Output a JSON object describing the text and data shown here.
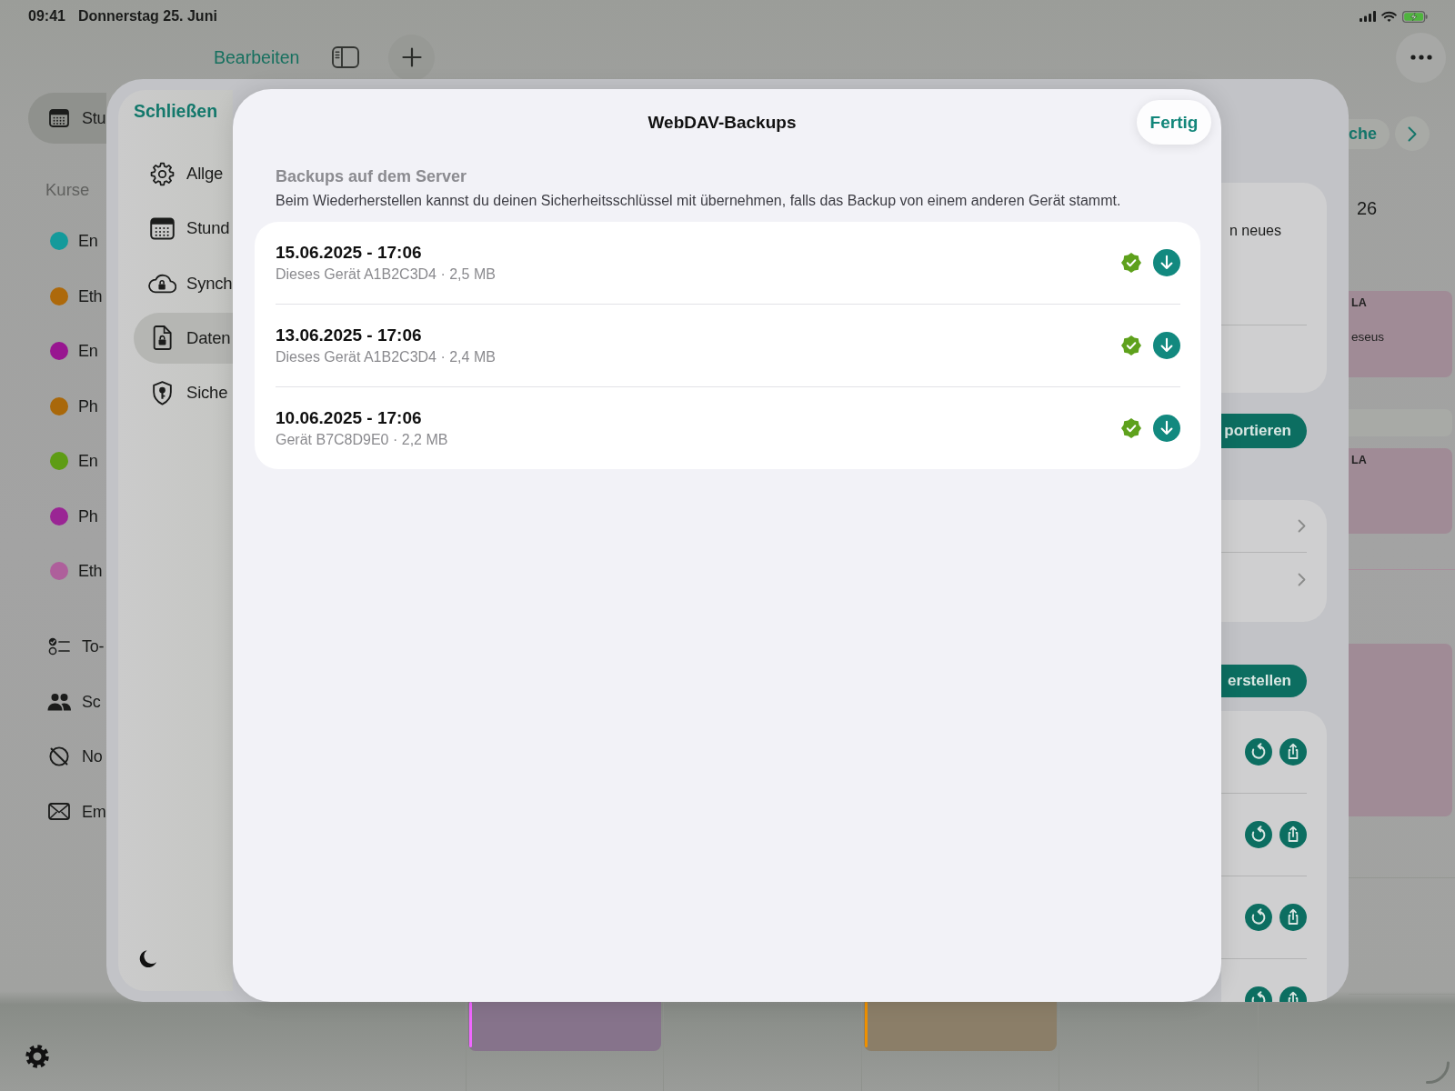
{
  "status_bar": {
    "time": "09:41",
    "date": "Donnerstag 25. Juni"
  },
  "toolbar": {
    "edit_button": "Bearbeiten"
  },
  "sidebar": {
    "items": [
      {
        "label": "Stu",
        "selected": true
      }
    ],
    "section_title": "Kurse",
    "courses": [
      {
        "label": "En",
        "color": "#149a9b",
        "selected": false
      },
      {
        "label": "Eth",
        "color": "#ad690b",
        "selected": false
      },
      {
        "label": "En",
        "color": "#981690",
        "selected": false
      },
      {
        "label": "Ph",
        "color": "#a9680a",
        "selected": false
      },
      {
        "label": "En",
        "color": "#5e9c14",
        "selected": false
      },
      {
        "label": "Ph",
        "color": "#9a2594",
        "selected": false
      },
      {
        "label": "Eth",
        "color": "#ae5f9b",
        "selected": false
      }
    ],
    "more_items": [
      {
        "label": "To-",
        "selected": false
      },
      {
        "label": "Sc",
        "selected": false
      },
      {
        "label": "No",
        "selected": false
      },
      {
        "label": "Em",
        "selected": false
      }
    ]
  },
  "calendar": {
    "week_button": "che",
    "day_number": "26",
    "events": [
      {
        "title": "LA",
        "subtitle": "eseus",
        "color": "#a08b96"
      },
      {
        "color": "#a8aaa6"
      },
      {
        "title": "LA",
        "color": "#a08b96"
      },
      {
        "color": "#a08b96"
      },
      {
        "color": "#86738b"
      },
      {
        "color": "#8b7e68"
      }
    ]
  },
  "settings_sheet": {
    "close_button": "Schließen",
    "items": [
      {
        "label": "Allge",
        "selected": false
      },
      {
        "label": "Stund",
        "selected": false
      },
      {
        "label": "Synch",
        "selected": false
      },
      {
        "label": "Daten",
        "selected": true
      },
      {
        "label": "Siche",
        "selected": false
      }
    ],
    "main": {
      "card_text": "n neues",
      "first_button": "portieren",
      "second_button": "erstellen"
    }
  },
  "modal": {
    "title": "WebDAV-Backups",
    "done_button": "Fertig",
    "section_header": "Backups auf dem Server",
    "section_note": "Beim Wiederherstellen kannst du deinen Sicherheitsschlüssel mit übernehmen, falls das Backup von einem anderen Gerät stammt.",
    "backups": [
      {
        "date": "15.06.2025 - 17:06",
        "details": "Dieses Gerät A1B2C3D4 · 2,5 MB",
        "verified": true
      },
      {
        "date": "13.06.2025 - 17:06",
        "details": "Dieses Gerät A1B2C3D4 · 2,4 MB",
        "verified": true
      },
      {
        "date": "10.06.2025 - 17:06",
        "details": "Gerät B7C8D9E0 · 2,2 MB",
        "verified": true
      }
    ]
  }
}
